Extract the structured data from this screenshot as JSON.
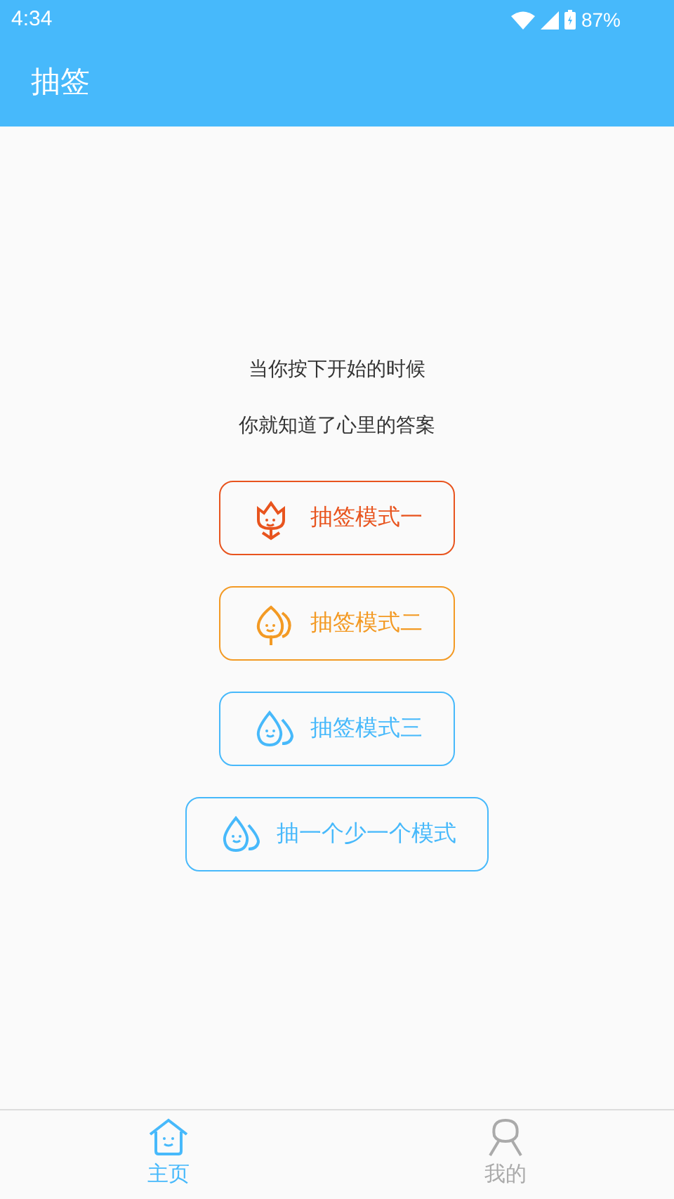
{
  "status_bar": {
    "time": "4:34",
    "battery": "87%"
  },
  "app_bar": {
    "title": "抽签"
  },
  "intro": [
    "当你按下开始的时候",
    "你就知道了心里的答案"
  ],
  "modes": [
    {
      "label": "抽签模式一",
      "kind": "flower",
      "color": "#e8541e"
    },
    {
      "label": "抽签模式二",
      "kind": "leaf",
      "color": "#f39a24"
    },
    {
      "label": "抽签模式三",
      "kind": "drop",
      "color": "#47b9fb"
    },
    {
      "label": "抽一个少一个模式",
      "kind": "drop",
      "color": "#47b9fb"
    }
  ],
  "bottom_nav": [
    {
      "label": "主页",
      "kind": "home",
      "selected": true
    },
    {
      "label": "我的",
      "kind": "person",
      "selected": false
    }
  ]
}
